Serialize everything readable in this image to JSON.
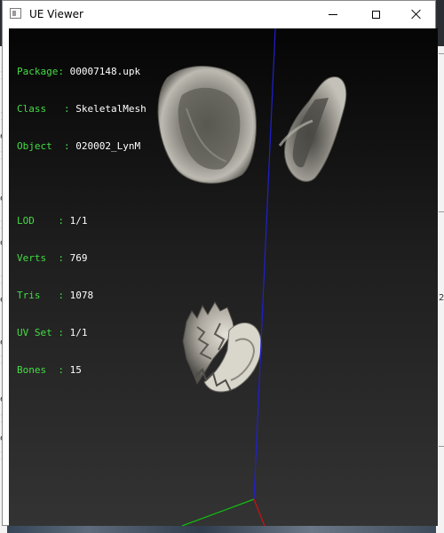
{
  "window": {
    "title": "UE Viewer"
  },
  "info_group1": [
    {
      "label": "Package: ",
      "value": "00007148.upk"
    },
    {
      "label": "Class   : ",
      "value": "SkeletalMesh"
    },
    {
      "label": "Object  : ",
      "value": "020002_LynM"
    }
  ],
  "info_group2": [
    {
      "label": "LOD    : ",
      "value": "1/1"
    },
    {
      "label": "Verts  : ",
      "value": "769"
    },
    {
      "label": "Tris   : ",
      "value": "1078"
    },
    {
      "label": "UV Set : ",
      "value": "1/1"
    },
    {
      "label": "Bones  : ",
      "value": "15"
    }
  ],
  "background": {
    "right_edge_digit": "2"
  },
  "axis_colors": {
    "x": "#d01010",
    "y": "#10c010",
    "z": "#2020d0"
  },
  "label_color": "#44dd44",
  "value_color": "#ffffff"
}
